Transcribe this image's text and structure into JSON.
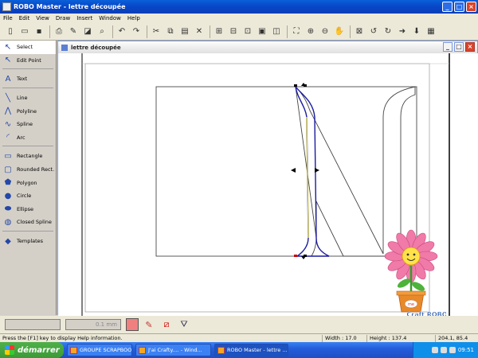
{
  "window": {
    "title": "ROBO Master - lettre découpée"
  },
  "menu": [
    "File",
    "Edit",
    "View",
    "Draw",
    "Insert",
    "Window",
    "Help"
  ],
  "toolbar": [
    {
      "name": "new-icon",
      "glyph": "▯"
    },
    {
      "name": "open-icon",
      "glyph": "▭"
    },
    {
      "name": "save-icon",
      "glyph": "▪"
    },
    {
      "sep": true
    },
    {
      "name": "print-icon",
      "glyph": "⎙"
    },
    {
      "name": "cut-to-robo-icon",
      "glyph": "✎"
    },
    {
      "name": "print-preview-icon",
      "glyph": "◪"
    },
    {
      "name": "find-icon",
      "glyph": "⌕"
    },
    {
      "sep": true
    },
    {
      "name": "undo-icon",
      "glyph": "↶"
    },
    {
      "name": "redo-icon",
      "glyph": "↷"
    },
    {
      "sep": true
    },
    {
      "name": "cut-icon",
      "glyph": "✂"
    },
    {
      "name": "copy-icon",
      "glyph": "⧉"
    },
    {
      "name": "paste-icon",
      "glyph": "▤"
    },
    {
      "name": "delete-icon",
      "glyph": "✕"
    },
    {
      "sep": true
    },
    {
      "name": "group-icon",
      "glyph": "⊞"
    },
    {
      "name": "ungroup-icon",
      "glyph": "⊟"
    },
    {
      "name": "align-icon",
      "glyph": "⊡"
    },
    {
      "name": "order-icon",
      "glyph": "▣"
    },
    {
      "name": "arrange-icon",
      "glyph": "◫"
    },
    {
      "sep": true
    },
    {
      "name": "fit-view-icon",
      "glyph": "⛶"
    },
    {
      "name": "zoom-in-icon",
      "glyph": "⊕"
    },
    {
      "name": "zoom-out-icon",
      "glyph": "⊖"
    },
    {
      "name": "pan-hand-icon",
      "glyph": "✋"
    },
    {
      "sep": true
    },
    {
      "name": "registration-icon",
      "glyph": "⊠"
    },
    {
      "name": "rotate-left-icon",
      "glyph": "↺"
    },
    {
      "name": "rotate-right-icon",
      "glyph": "↻"
    },
    {
      "name": "forward-icon",
      "glyph": "➜"
    },
    {
      "name": "send-icon",
      "glyph": "⬇"
    },
    {
      "name": "grid-icon",
      "glyph": "▦"
    }
  ],
  "sidebar": {
    "items": [
      {
        "label": "Select",
        "icon": "select-arrow-icon",
        "glyph": "↖",
        "selected": true
      },
      {
        "label": "Edit Point",
        "icon": "edit-point-icon",
        "glyph": "↖"
      },
      {
        "gap": true
      },
      {
        "label": "Text",
        "icon": "text-icon",
        "glyph": "A"
      },
      {
        "gap": true
      },
      {
        "label": "Line",
        "icon": "line-icon",
        "glyph": "╲"
      },
      {
        "label": "Polyline",
        "icon": "polyline-icon",
        "glyph": "⋀"
      },
      {
        "label": "Spline",
        "icon": "spline-icon",
        "glyph": "∿"
      },
      {
        "label": "Arc",
        "icon": "arc-icon",
        "glyph": "◜"
      },
      {
        "gap": true
      },
      {
        "label": "Rectangle",
        "icon": "rectangle-icon",
        "glyph": "▭"
      },
      {
        "label": "Rounded Rect.",
        "icon": "rounded-rect-icon",
        "glyph": "▢"
      },
      {
        "label": "Polygon",
        "icon": "polygon-icon",
        "glyph": "⬟"
      },
      {
        "label": "Circle",
        "icon": "circle-icon",
        "glyph": "●"
      },
      {
        "label": "Ellipse",
        "icon": "ellipse-icon",
        "glyph": "⬬"
      },
      {
        "label": "Closed Spline",
        "icon": "closed-spline-icon",
        "glyph": "◍"
      },
      {
        "gap": true
      },
      {
        "label": "Templates",
        "icon": "templates-icon",
        "glyph": "◆"
      }
    ]
  },
  "document": {
    "title": "lettre découpée"
  },
  "bottom": {
    "line_width": "0.1 mm",
    "fill_color": "#f08080"
  },
  "status": {
    "hint": "Press the [F1] key to display Help information.",
    "width": "Width : 17.0",
    "height": "Height : 137.4",
    "coords": "204.1, 85.4"
  },
  "taskbar": {
    "start": "démarrer",
    "tasks": [
      {
        "label": "GROUPE SCRAPBOO..."
      },
      {
        "label": "J'ai Crafty.... - Wind..."
      },
      {
        "label": "ROBO Master - lettre ...",
        "active": true
      }
    ],
    "clock": "09:51"
  },
  "watermark": {
    "brand": "Craft ROBO",
    "pot_label": "me"
  }
}
